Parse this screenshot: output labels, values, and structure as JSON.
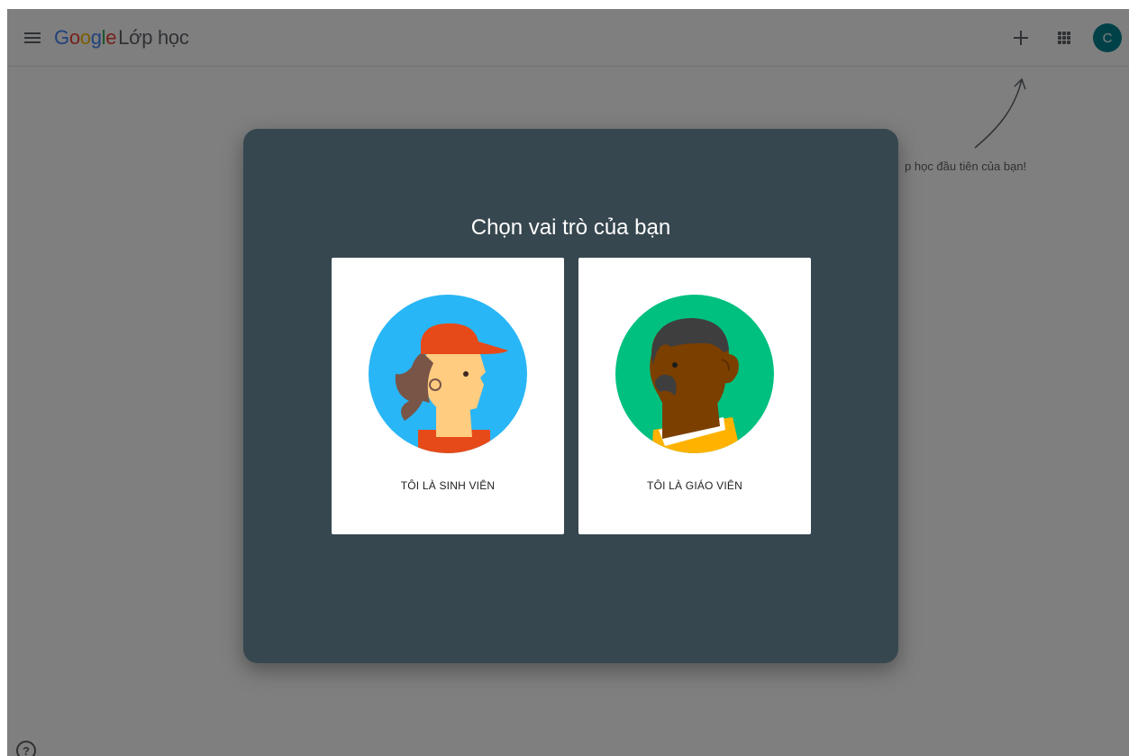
{
  "header": {
    "logo_google": [
      "G",
      "o",
      "o",
      "g",
      "l",
      "e"
    ],
    "logo_colors": [
      "#4285F4",
      "#EA4335",
      "#FBBC05",
      "#4285F4",
      "#34A853",
      "#EA4335"
    ],
    "product_name": "Lớp học",
    "avatar_letter": "C",
    "avatar_color": "#00838f"
  },
  "background": {
    "hint": "p học đầu tiên của bạn!"
  },
  "dialog": {
    "title": "Chọn vai trò của bạn",
    "roles": [
      {
        "label": "TÔI LÀ SINH VIÊN",
        "illustration": "student-illustration"
      },
      {
        "label": "TÔI LÀ GIÁO VIÊN",
        "illustration": "teacher-illustration"
      }
    ],
    "background_color": "#37474f"
  },
  "help": {
    "glyph": "?"
  }
}
